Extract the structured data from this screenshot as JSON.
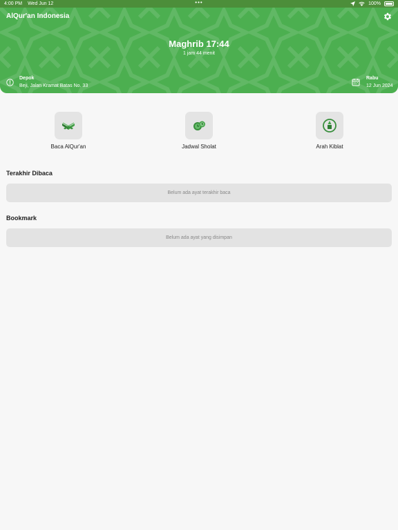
{
  "status_bar": {
    "time": "4:00 PM",
    "date": "Wed Jun 12",
    "battery": "100%"
  },
  "header": {
    "app_title": "AlQur'an Indonesia",
    "prayer": "Maghrib 17:44",
    "remaining": "1 jam 44 menit",
    "location_city": "Depok",
    "location_address": "Beji, Jalan Kramat Batas No. 33",
    "day": "Rabu",
    "date": "12 Jun 2024"
  },
  "menu": [
    {
      "label": "Baca AlQur'an",
      "icon": "quran-icon"
    },
    {
      "label": "Jadwal Sholat",
      "icon": "prayer-time-icon"
    },
    {
      "label": "Arah Kiblat",
      "icon": "qibla-compass-icon"
    }
  ],
  "last_read": {
    "title": "Terakhir Dibaca",
    "empty_text": "Belum ada ayat terakhir baca"
  },
  "bookmark": {
    "title": "Bookmark",
    "empty_text": "Belum ada ayat yang disimpan"
  },
  "colors": {
    "primary": "#4caf50",
    "status_bar": "#4c8e3a",
    "tile": "#e4e4e4",
    "background": "#f7f7f7"
  }
}
